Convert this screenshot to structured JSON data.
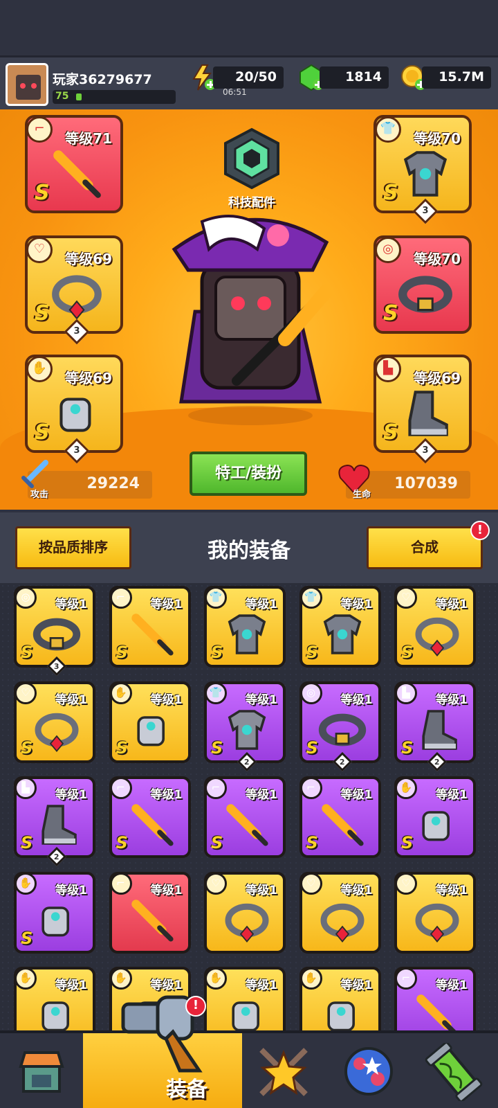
{
  "header": {
    "player_name": "玩家36279677",
    "player_level": "75",
    "avatar_badge": "54",
    "xp_fraction": 0.03,
    "energy": "20/50",
    "energy_timer": "06:51",
    "gems": "1814",
    "coins": "15.7M"
  },
  "hero": {
    "tech_label": "科技配件",
    "attack_label": "攻击",
    "attack_value": "29224",
    "hp_label": "生命",
    "hp_value": "107039",
    "agent_button": "特工/装扮",
    "slots": [
      {
        "pos": "left-1",
        "level": "等级71",
        "grade": "S",
        "color": "red",
        "icon": "gun-icon",
        "item": "sword-icon",
        "stars": ""
      },
      {
        "pos": "left-2",
        "level": "等级69",
        "grade": "S",
        "color": "gold",
        "icon": "necklace-icon",
        "item": "ring-icon",
        "stars": "3"
      },
      {
        "pos": "left-3",
        "level": "等级69",
        "grade": "S",
        "color": "gold",
        "icon": "glove-icon",
        "item": "gauntlet-icon",
        "stars": "3"
      },
      {
        "pos": "right-1",
        "level": "等级70",
        "grade": "S",
        "color": "gold",
        "icon": "shirt-icon",
        "item": "armor-icon",
        "stars": "3"
      },
      {
        "pos": "right-2",
        "level": "等级70",
        "grade": "S",
        "color": "red",
        "icon": "belt-icon",
        "item": "belt-item-icon",
        "stars": ""
      },
      {
        "pos": "right-3",
        "level": "等级69",
        "grade": "S",
        "color": "gold",
        "icon": "boot-icon",
        "item": "boot-item-icon",
        "stars": "3"
      }
    ]
  },
  "inventory": {
    "sort_button": "按品质排序",
    "title": "我的装备",
    "merge_button": "合成",
    "alert": "!",
    "items": [
      {
        "level": "等级1",
        "grade": "S",
        "color": "gold",
        "icon": "belt-icon",
        "stars": "3"
      },
      {
        "level": "等级1",
        "grade": "S",
        "color": "gold",
        "icon": "gun-icon",
        "stars": ""
      },
      {
        "level": "等级1",
        "grade": "S",
        "color": "gold",
        "icon": "shirt-icon",
        "stars": ""
      },
      {
        "level": "等级1",
        "grade": "S",
        "color": "gold",
        "icon": "shirt-icon",
        "stars": ""
      },
      {
        "level": "等级1",
        "grade": "S",
        "color": "gold",
        "icon": "necklace-icon",
        "stars": ""
      },
      {
        "level": "等级1",
        "grade": "S",
        "color": "gold",
        "icon": "necklace-icon",
        "stars": ""
      },
      {
        "level": "等级1",
        "grade": "S",
        "color": "gold",
        "icon": "glove-icon",
        "stars": ""
      },
      {
        "level": "等级1",
        "grade": "S",
        "color": "purple",
        "icon": "shirt-icon",
        "stars": "2"
      },
      {
        "level": "等级1",
        "grade": "S",
        "color": "purple",
        "icon": "belt-icon",
        "stars": "2"
      },
      {
        "level": "等级1",
        "grade": "S",
        "color": "purple",
        "icon": "boot-icon",
        "stars": "2"
      },
      {
        "level": "等级1",
        "grade": "S",
        "color": "purple",
        "icon": "boot-icon",
        "stars": "2"
      },
      {
        "level": "等级1",
        "grade": "S",
        "color": "purple",
        "icon": "gun-icon",
        "stars": ""
      },
      {
        "level": "等级1",
        "grade": "S",
        "color": "purple",
        "icon": "gun-icon",
        "stars": ""
      },
      {
        "level": "等级1",
        "grade": "S",
        "color": "purple",
        "icon": "gun-icon",
        "stars": ""
      },
      {
        "level": "等级1",
        "grade": "S",
        "color": "purple",
        "icon": "glove-icon",
        "stars": ""
      },
      {
        "level": "等级1",
        "grade": "S",
        "color": "purple",
        "icon": "glove-icon",
        "stars": ""
      },
      {
        "level": "等级1",
        "grade": "",
        "color": "red",
        "icon": "gun-icon",
        "stars": ""
      },
      {
        "level": "等级1",
        "grade": "",
        "color": "gold",
        "icon": "necklace-icon",
        "stars": ""
      },
      {
        "level": "等级1",
        "grade": "",
        "color": "gold",
        "icon": "necklace-icon",
        "stars": ""
      },
      {
        "level": "等级1",
        "grade": "",
        "color": "gold",
        "icon": "necklace-icon",
        "stars": ""
      },
      {
        "level": "等级1",
        "grade": "",
        "color": "gold",
        "icon": "glove-icon",
        "stars": ""
      },
      {
        "level": "等级1",
        "grade": "",
        "color": "gold",
        "icon": "glove-icon",
        "stars": ""
      },
      {
        "level": "等级1",
        "grade": "",
        "color": "gold",
        "icon": "glove-icon",
        "stars": ""
      },
      {
        "level": "等级1",
        "grade": "",
        "color": "gold",
        "icon": "glove-icon",
        "stars": ""
      },
      {
        "level": "等级1",
        "grade": "",
        "color": "purple",
        "icon": "gun-icon",
        "stars": ""
      }
    ]
  },
  "nav": {
    "active_label": "装备",
    "alert": "!",
    "tabs": [
      "shop-icon",
      "equipment-icon",
      "star-swords-icon",
      "planet-icon",
      "dna-capsule-icon"
    ]
  },
  "colors": {
    "gold": "#f7b71a",
    "purple": "#9b3ee0",
    "red": "#e33a4e",
    "green": "#4fb72c",
    "background": "#2b2e3a"
  }
}
